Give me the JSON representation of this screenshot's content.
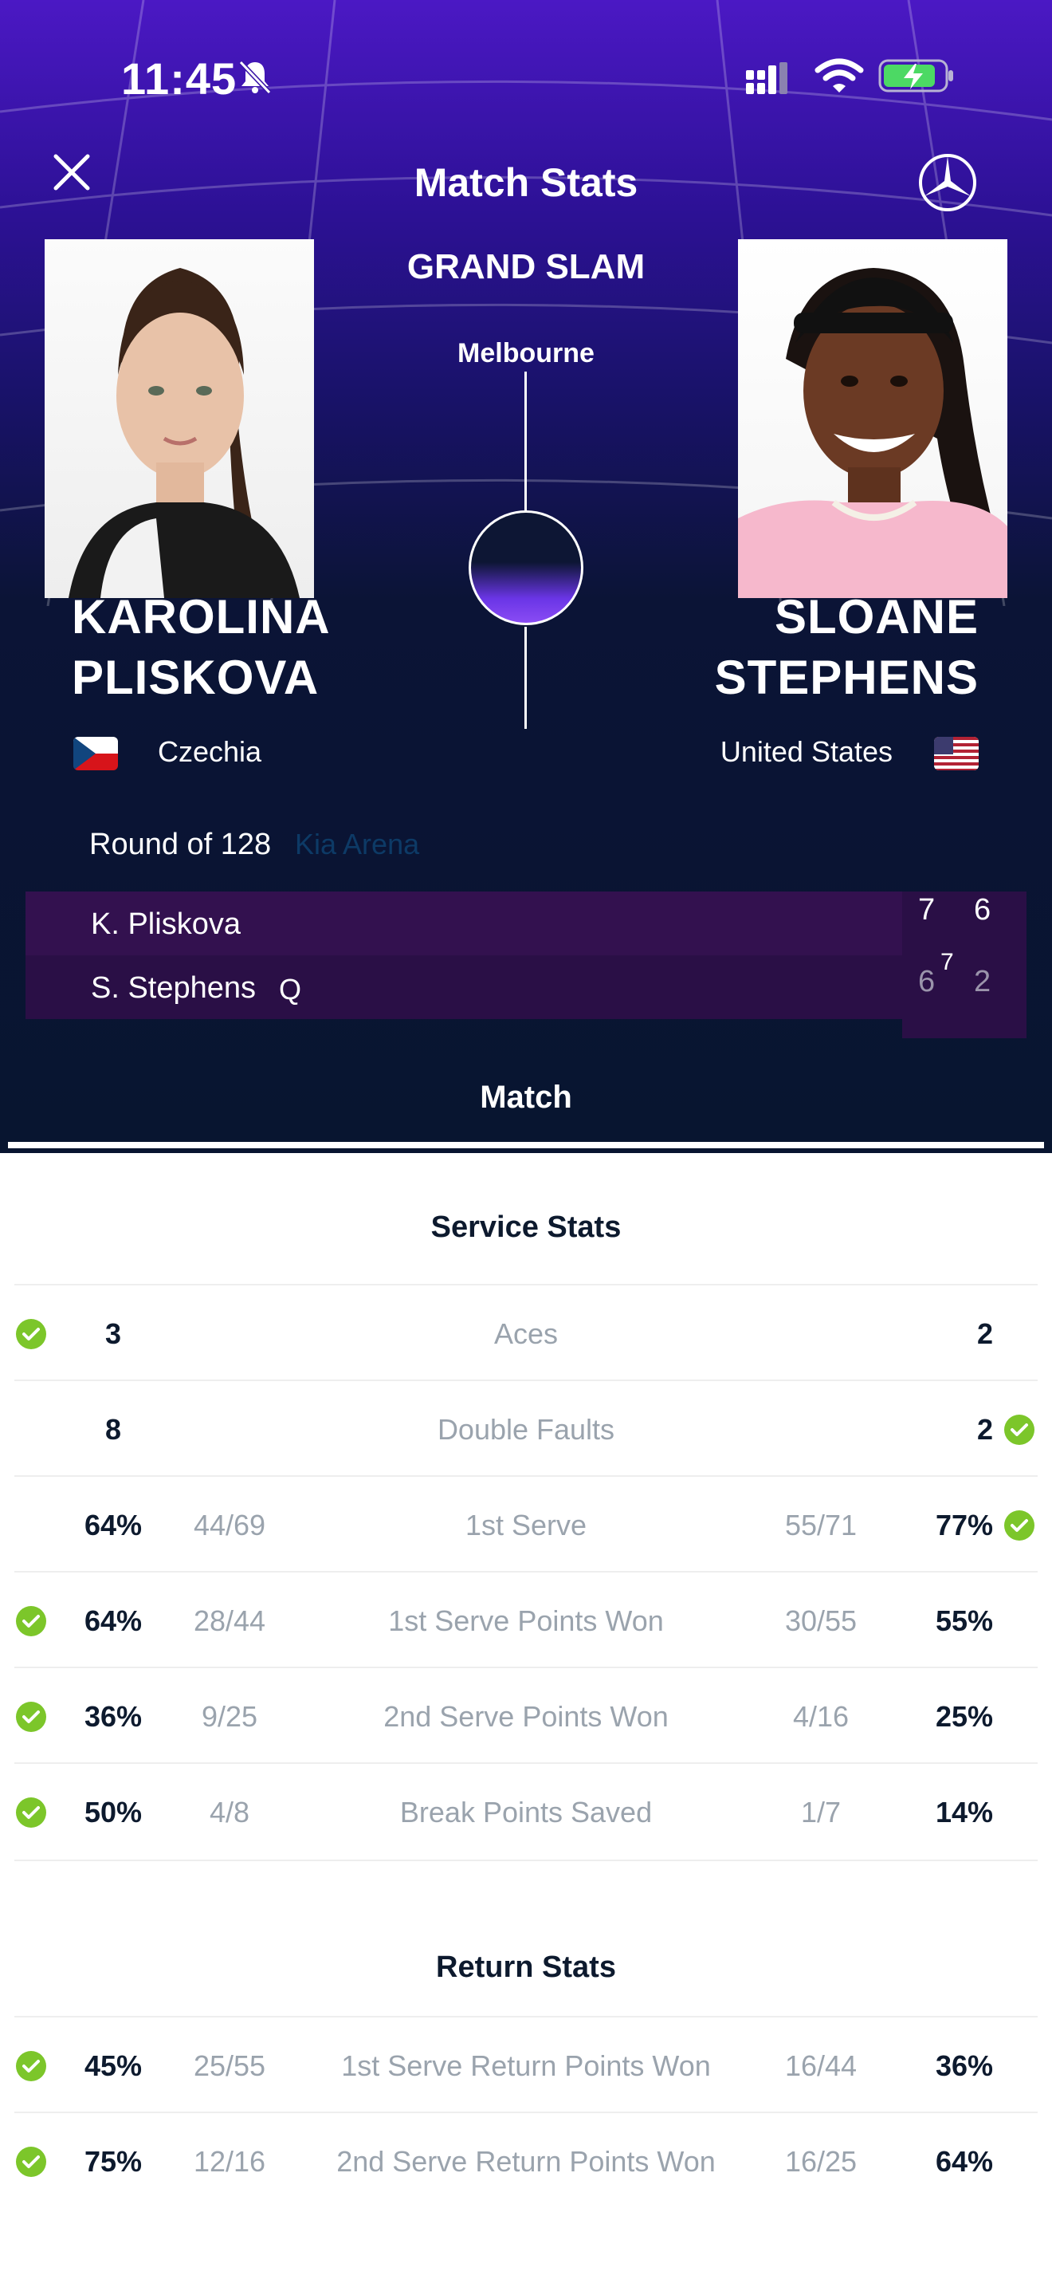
{
  "status_bar": {
    "time": "11:45"
  },
  "header": {
    "title": "Match Stats"
  },
  "match": {
    "tournament": "GRAND SLAM",
    "city": "Melbourne",
    "round": "Round of 128",
    "court": "Kia Arena"
  },
  "players": {
    "left": {
      "first": "KAROLINA",
      "last": "PLISKOVA",
      "country": "Czechia"
    },
    "right": {
      "first": "SLOANE",
      "last": "STEPHENS",
      "country": "United States"
    }
  },
  "scoreboard": {
    "rows": [
      {
        "name": "K. Pliskova",
        "seed": "",
        "sets": [
          "7",
          "6"
        ]
      },
      {
        "name": "S. Stephens",
        "seed": "Q",
        "sets": [
          "6",
          "2"
        ],
        "tiebreak": "7"
      }
    ]
  },
  "tabs": {
    "match": "Match"
  },
  "service_stats": {
    "title": "Service Stats",
    "rows": [
      {
        "label": "Aces",
        "left": "3",
        "right": "2",
        "left_frac": "",
        "right_frac": ""
      },
      {
        "label": "Double Faults",
        "left": "8",
        "right": "2",
        "left_frac": "",
        "right_frac": ""
      },
      {
        "label": "1st Serve",
        "left": "64%",
        "left_frac": "44/69",
        "right_frac": "55/71",
        "right": "77%"
      },
      {
        "label": "1st Serve Points Won",
        "left": "64%",
        "left_frac": "28/44",
        "right_frac": "30/55",
        "right": "55%"
      },
      {
        "label": "2nd Serve Points Won",
        "left": "36%",
        "left_frac": "9/25",
        "right_frac": "4/16",
        "right": "25%"
      },
      {
        "label": "Break Points Saved",
        "left": "50%",
        "left_frac": "4/8",
        "right_frac": "1/7",
        "right": "14%"
      }
    ]
  },
  "return_stats": {
    "title": "Return Stats",
    "rows": [
      {
        "label": "1st Serve Return Points Won",
        "left": "45%",
        "left_frac": "25/55",
        "right_frac": "16/44",
        "right": "36%"
      },
      {
        "label": "2nd Serve Return Points Won",
        "left": "75%",
        "left_frac": "12/16",
        "right_frac": "16/25",
        "right": "64%"
      }
    ]
  },
  "colors": {
    "check_green": "#7cc62a",
    "brand_purple": "#4b18c4",
    "dark_navy": "#081530"
  }
}
